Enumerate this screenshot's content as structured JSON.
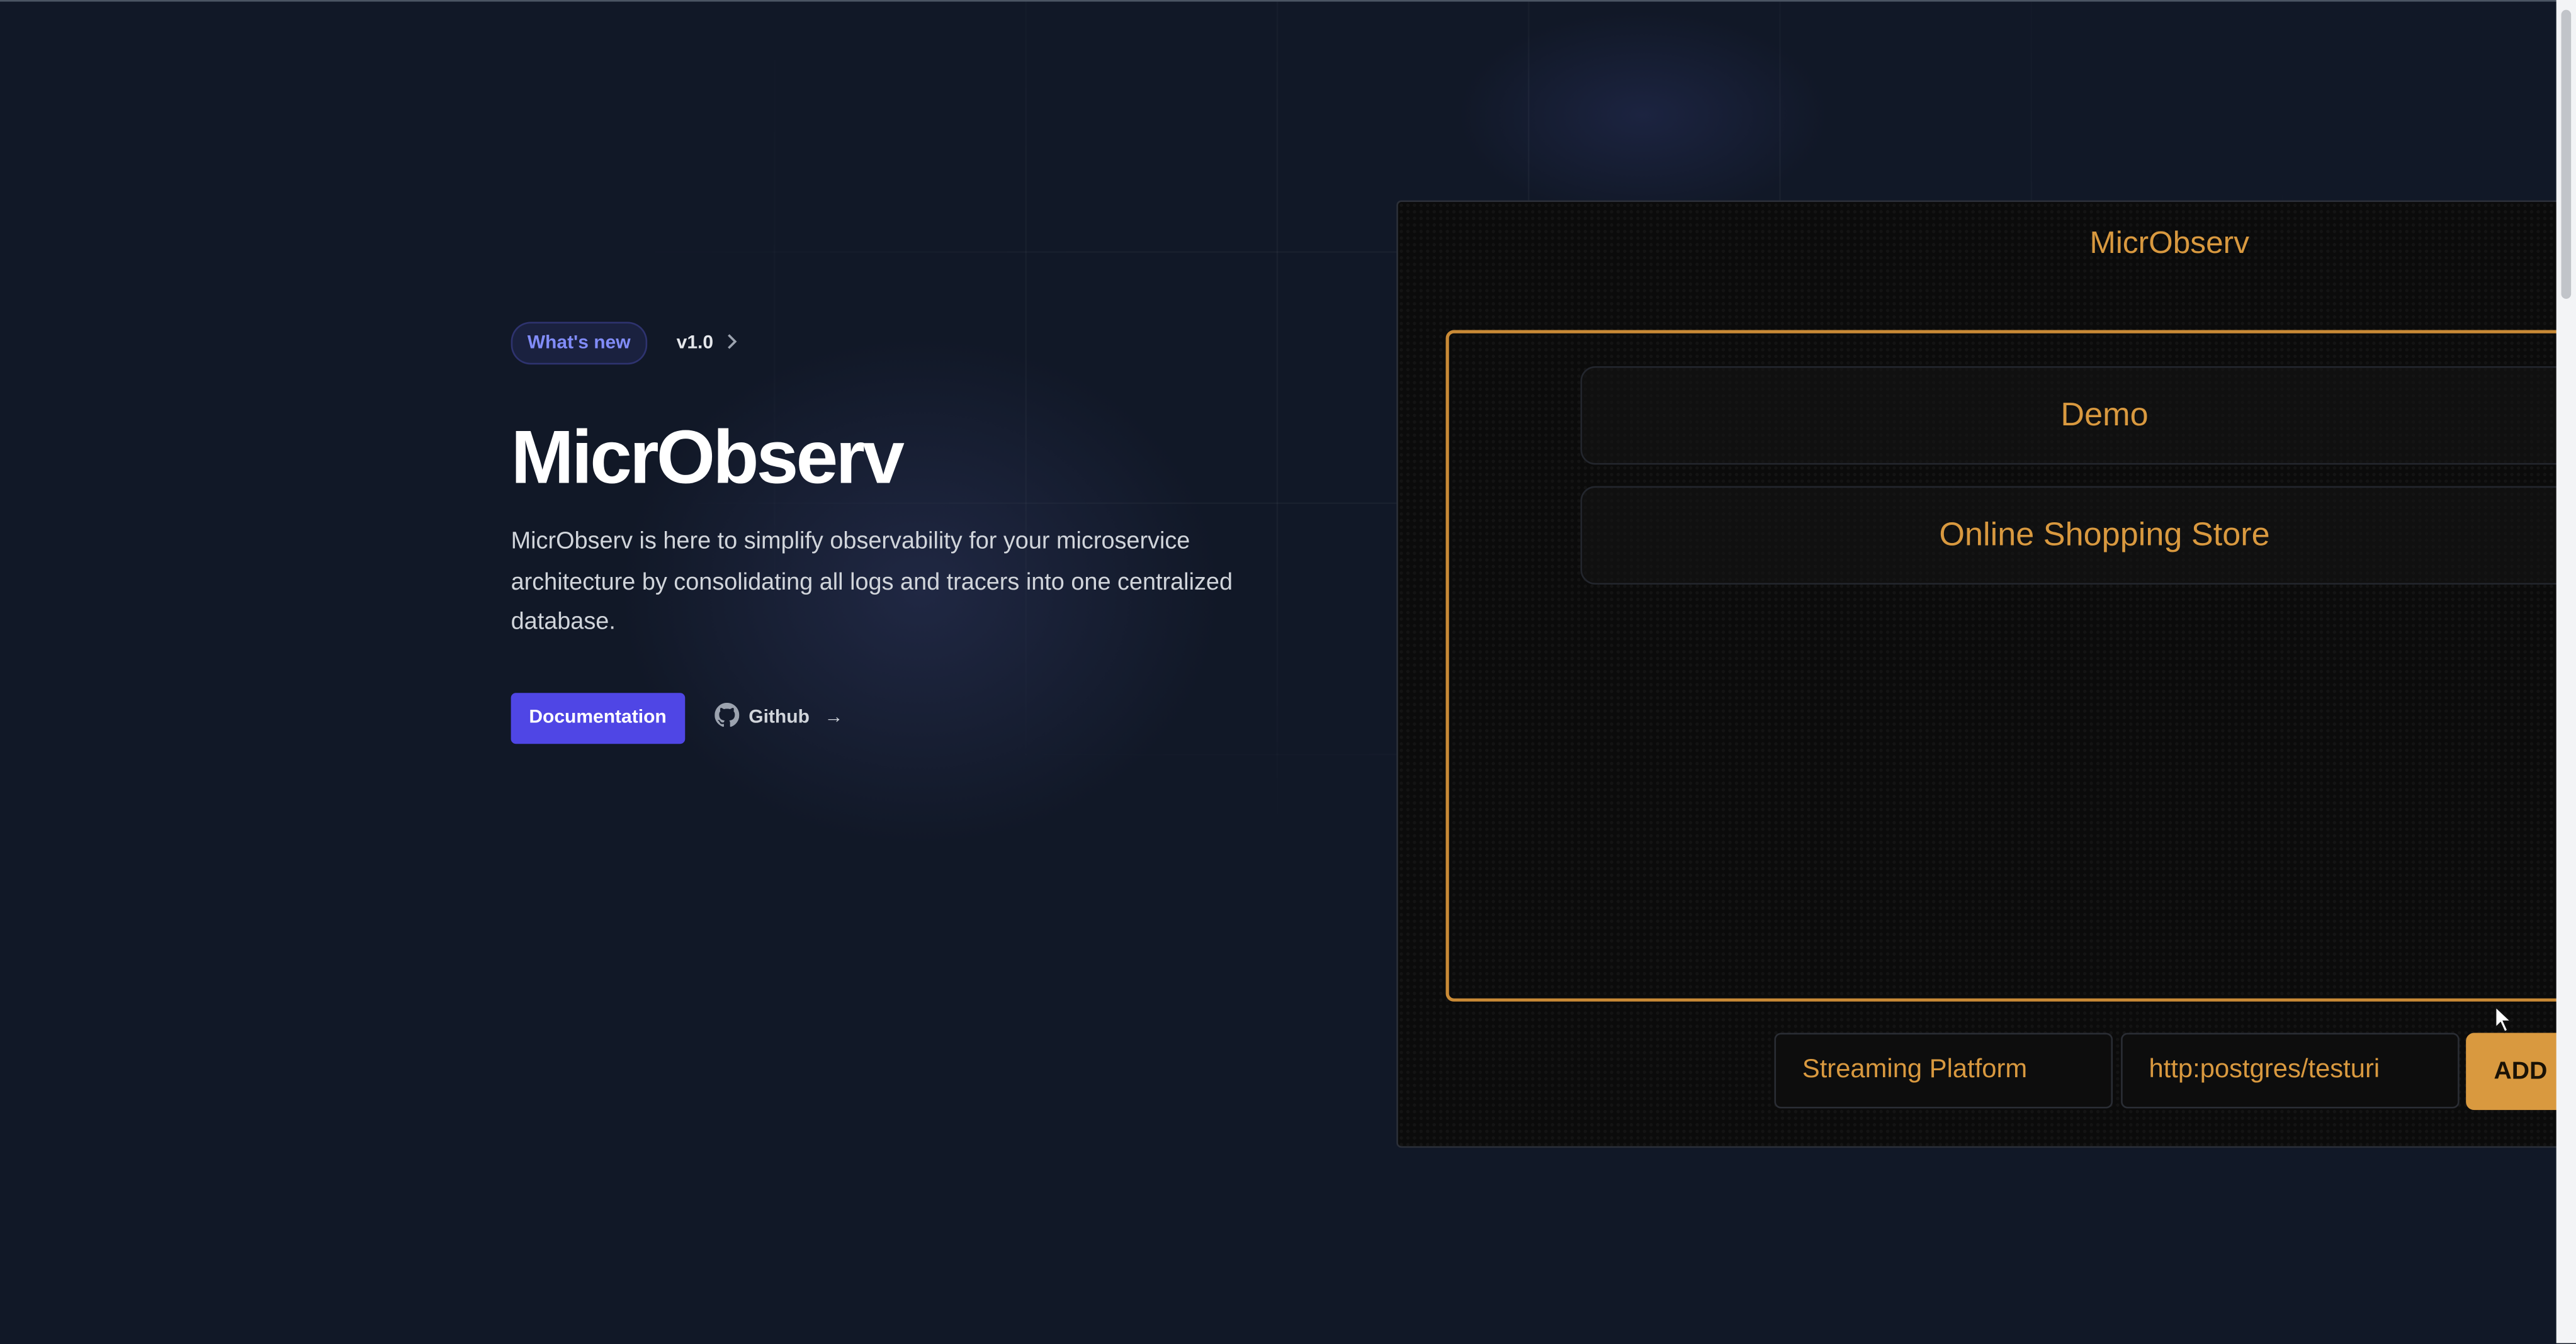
{
  "hero": {
    "badge": "What's new",
    "version": "v1.0",
    "title": "MicrObserv",
    "description": "MicrObserv is here to simplify observability for your microservice architecture by consolidating all logs and tracers into one centralized database.",
    "primary_button": "Documentation",
    "secondary_button": "Github",
    "secondary_arrow": "→"
  },
  "app": {
    "title": "MicrObserv",
    "projects": [
      "Demo",
      "Online Shopping Store"
    ],
    "name_input_value": "Streaming Platform",
    "uri_input_value": "http:postgres/testuri",
    "add_button": "ADD"
  },
  "colors": {
    "background": "#111827",
    "accent": "#4f46e5",
    "badge_text": "#818cf8",
    "app_accent": "#d9993f",
    "app_background": "#0b0b0b"
  },
  "icons": [
    "chevron-right-icon",
    "github-icon",
    "arrow-right-icon",
    "mouse-cursor-icon"
  ]
}
